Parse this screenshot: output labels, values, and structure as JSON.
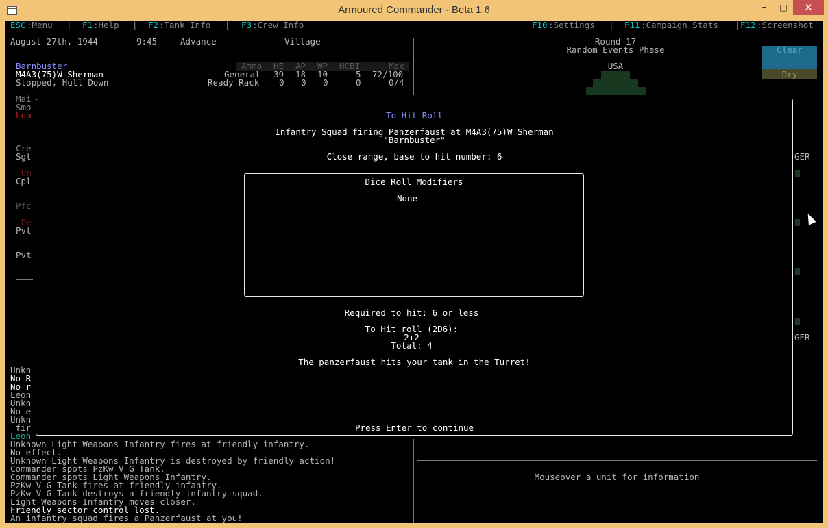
{
  "window": {
    "title": "Armoured Commander - Beta 1.6",
    "min": "–",
    "max": "□",
    "close": "✕"
  },
  "menubar": {
    "esc_key": "ESC",
    "esc_label": ":Menu",
    "sep": "|",
    "f1_key": "F1",
    "f1_label": ":Help",
    "f2_key": "F2",
    "f2_label": ":Tank Info",
    "f3_key": "F3",
    "f3_label": ":Crew Info",
    "f10_key": "F10",
    "f10_label": ":Settings",
    "f11_key": "F11",
    "f11_label": ":Campaign Stats",
    "f12_key": "F12",
    "f12_label": ":Screenshot"
  },
  "status": {
    "date": "August 27th, 1944",
    "time": "9:45",
    "mode": "Advance",
    "terrain": "Village"
  },
  "round": {
    "label": "Round 17",
    "phase": "Random Events Phase",
    "side": "USA"
  },
  "weather": {
    "sky": "Clear",
    "ground": "Dry"
  },
  "tank": {
    "name": "Barnbuster",
    "model": "M4A3(75)W Sherman",
    "state": "Stopped, Hull Down"
  },
  "ammo": {
    "headers": [
      "Ammo",
      "HE",
      "AP",
      "WP",
      "HCBI",
      "Max"
    ],
    "rows": [
      {
        "label": "General",
        "he": "39",
        "ap": "18",
        "wp": "10",
        "hcbi": "5",
        "max": "72/100"
      },
      {
        "label": "Ready Rack",
        "he": "0",
        "ap": "0",
        "wp": "0",
        "hcbi": "0",
        "max": "0/4"
      }
    ]
  },
  "left_partial": {
    "a1": "Mai",
    "a2": "Smo",
    "a3": "Loa",
    "b1": "Cre",
    "b2": "Sgt",
    "b3": "Un",
    "b4": "Cpl",
    "b5": "Pfc",
    "b6": "De",
    "b7": "Pvt",
    "b8": "Pvt",
    "c1": "Unkn",
    "c2": "No R",
    "c3": "No r",
    "c4": "Leon",
    "c5": "Unkn",
    "c6": "No e",
    "c7": "Unkn",
    "c8": " fir",
    "c9": "Leon"
  },
  "right_partial": {
    "ger1": "GER",
    "ger2": "GER"
  },
  "dialog": {
    "title": "To Hit Roll",
    "attack_line1": "Infantry Squad firing Panzerfaust at M4A3(75)W Sherman",
    "attack_line2": "\"Barnbuster\"",
    "range_line": "Close range, base to hit number: 6",
    "modifiers_title": "Dice Roll Modifiers",
    "modifiers_value": "None",
    "required": "Required to hit: 6 or less",
    "roll_title": "To Hit roll (2D6):",
    "roll_dice": "2+2",
    "roll_total": "Total: 4",
    "result": "The panzerfaust hits your tank in the Turret!",
    "continue": "Press Enter to continue"
  },
  "log": [
    "Unknown Light Weapons Infantry fires at friendly infantry.",
    "No effect.",
    "Unknown Light Weapons Infantry is destroyed by friendly action!",
    "Commander spots PzKw V G Tank.",
    "Commander spots Light Weapons Infantry.",
    "PzKw V G Tank fires at friendly infantry.",
    "PzKw V G Tank destroys a friendly infantry squad.",
    "Light Weapons Infantry moves closer.",
    "Friendly sector control lost.",
    "An infantry squad fires a Panzerfaust at you!"
  ],
  "info_hint": "Mouseover a unit for information"
}
